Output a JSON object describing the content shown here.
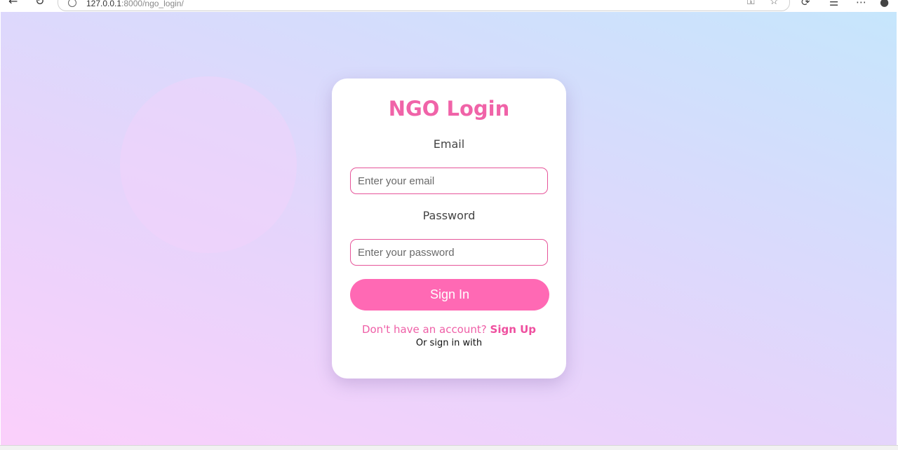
{
  "browser": {
    "url_host": "127.0.0.1",
    "url_rest": ":8000/ngo_login/"
  },
  "login": {
    "title": "NGO Login",
    "email_label": "Email",
    "email_placeholder": "Enter your email",
    "password_label": "Password",
    "password_placeholder": "Enter your password",
    "signin_label": "Sign In",
    "no_account_text": "Don't have an account?",
    "signup_label": "Sign Up",
    "alt_signin_text": "Or sign in with"
  },
  "colors": {
    "accent": "#ff69b4",
    "title": "#f063a8",
    "input_border": "#e6559a"
  }
}
